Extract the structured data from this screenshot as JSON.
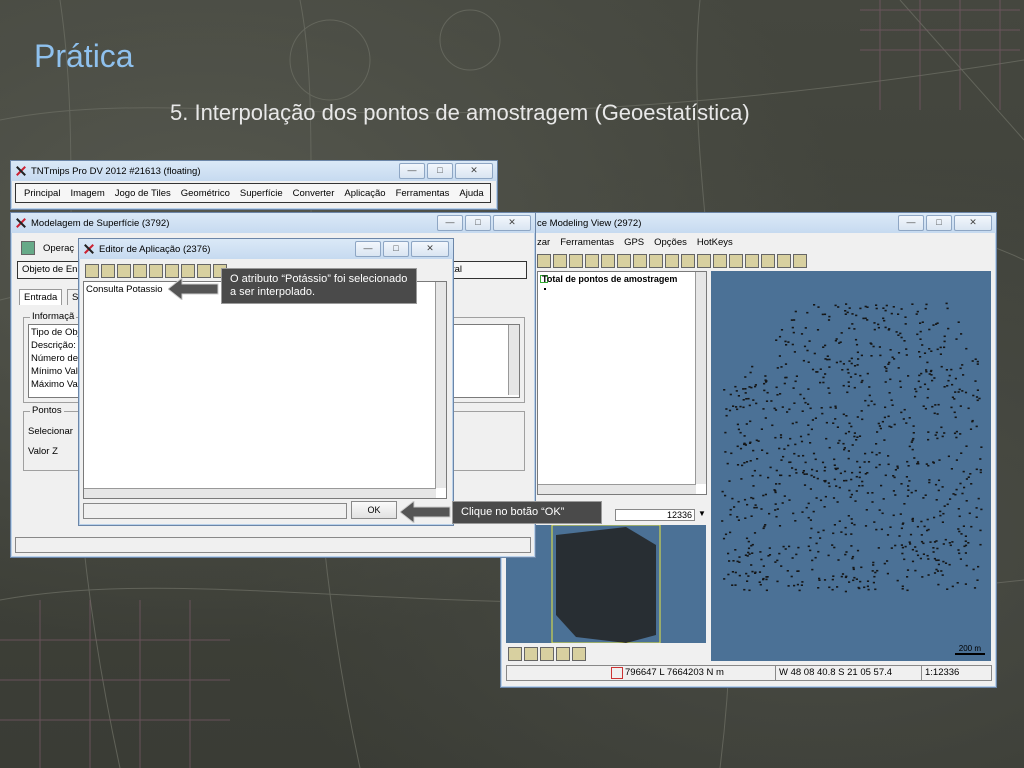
{
  "slide": {
    "title": "Prática",
    "subtitle": "5. Interpolação dos pontos de amostragem (Geoestatística)"
  },
  "main_window": {
    "title": "TNTmips Pro DV 2012  #21613 (floating)",
    "menu": [
      "Principal",
      "Imagem",
      "Jogo de Tiles",
      "Geométrico",
      "Superfície",
      "Converter",
      "Aplicação",
      "Ferramentas",
      "Ajuda"
    ]
  },
  "surface_window": {
    "title": "Modelagem de Superfície (3792)",
    "operation_label": "Operaç",
    "object_label": "Objeto de En",
    "object_suffix": "tal",
    "tabs": [
      "Entrada",
      "S"
    ],
    "info_group": "Informaçã",
    "info_fields": [
      "Tipo de Obj",
      "Descrição:",
      "Número de",
      "Mínimo Valo",
      "Máximo Valo"
    ],
    "points_group": "Pontos",
    "select_label": "Selecionar",
    "z_label": "Valor Z"
  },
  "editor_window": {
    "title": "Editor de Aplicação (2376)",
    "content_text": "Consulta Potassio",
    "ok_label": "OK"
  },
  "view_window": {
    "title": "ce Modeling View (2972)",
    "menu": [
      "zar",
      "Ferramentas",
      "GPS",
      "Opções",
      "HotKeys"
    ],
    "layer_label": "Total de pontos de amostragem",
    "count_value": "12336",
    "scale_bar": "200 m",
    "status_coords": "796647 L  7664203 N m",
    "status_latlon": "W 48 08 40.8  S 21 05 57.4",
    "status_scale": "1:12336"
  },
  "callouts": {
    "potassio": "O atributo “Potássio” foi selecionado a ser interpolado.",
    "ok": "Clique no botão “OK”"
  },
  "colors": {
    "map_background": "#4b7196",
    "title_accent": "#8fc1ee",
    "callout_bg": "#4a4a4a"
  }
}
